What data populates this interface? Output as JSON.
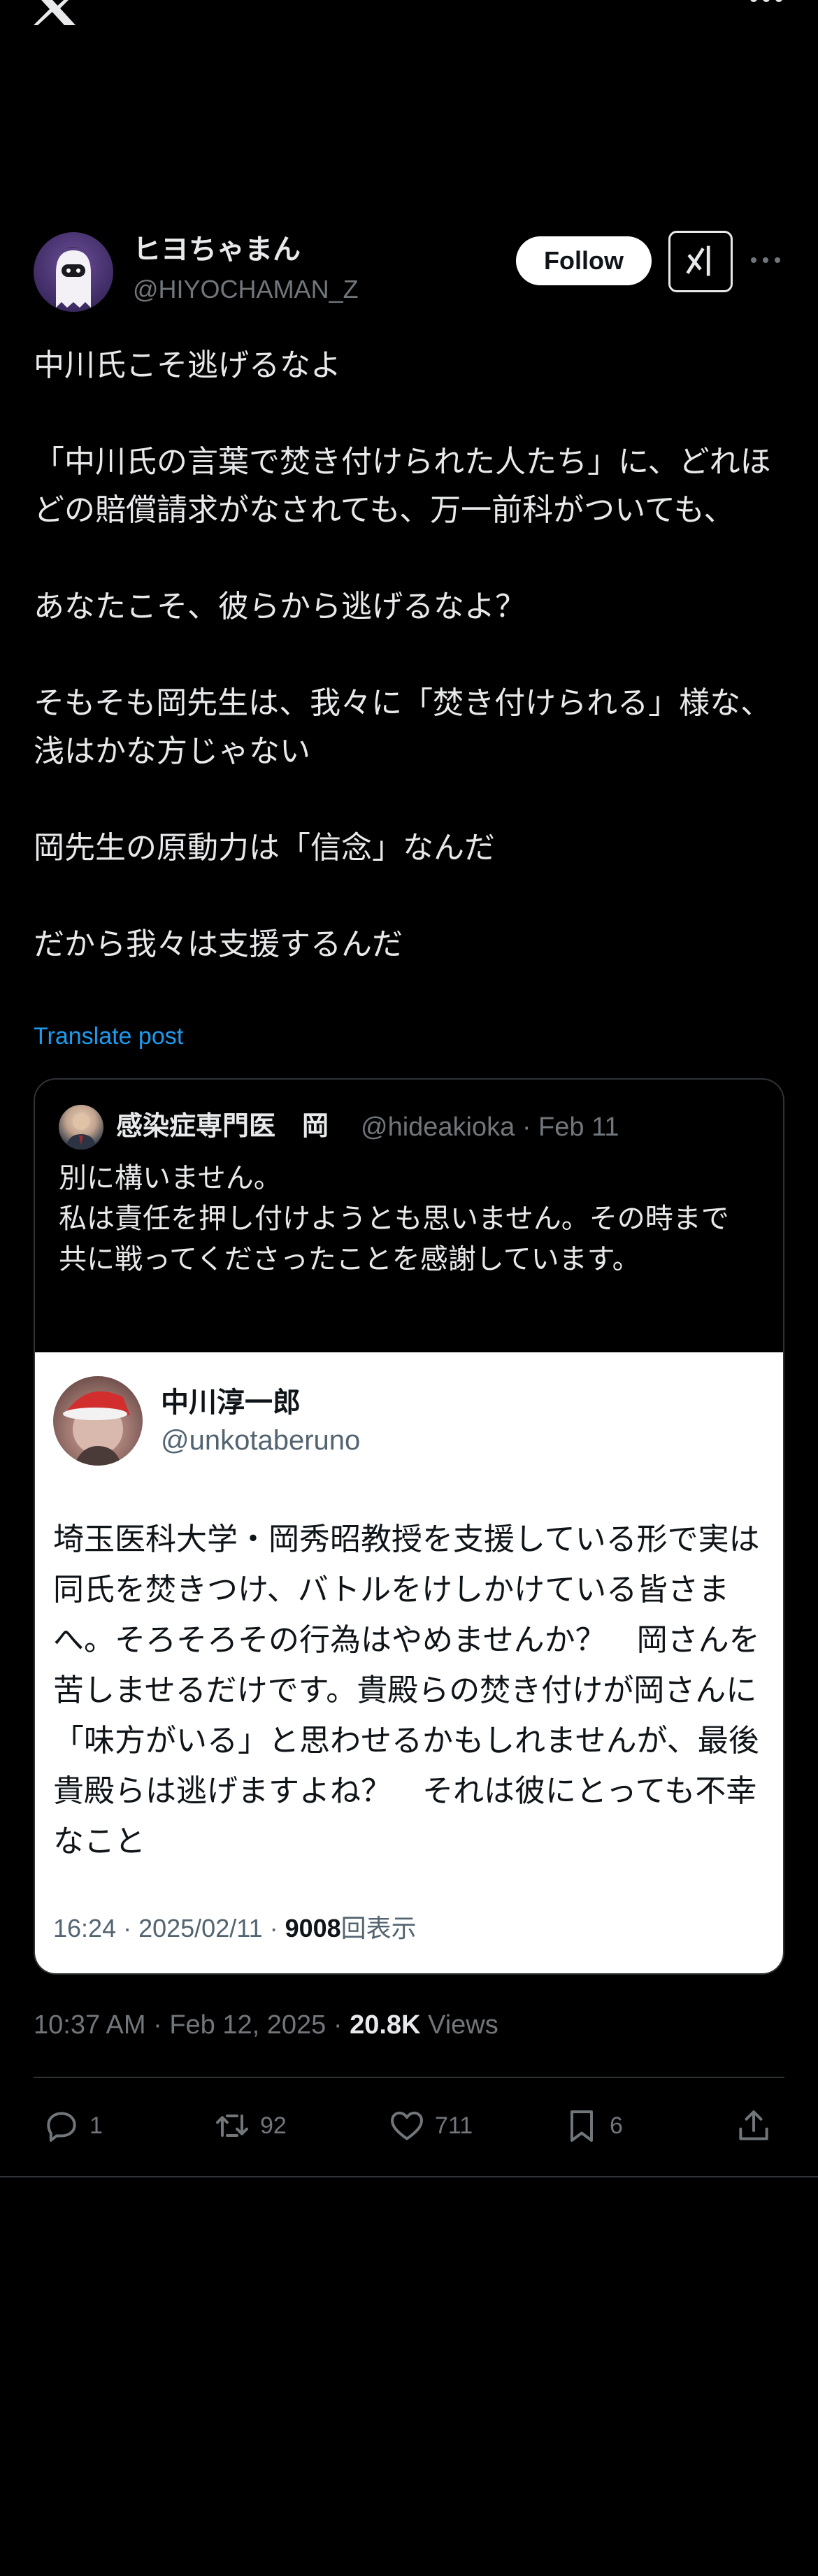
{
  "header": {
    "display_name": "ヒヨちゃまん",
    "handle": "@HIYOCHAMAN_Z",
    "follow_label": "Follow"
  },
  "tweet": {
    "paragraphs": [
      "中川氏こそ逃げるなよ",
      "「中川氏の言葉で焚き付けられた人たち」に、どれほどの賠償請求がなされても、万一前科がついても、",
      "あなたこそ、彼らから逃げるなよ？",
      "そもそも岡先生は、我々に「焚き付けられる」様な、浅はかな方じゃない",
      "岡先生の原動力は「信念」なんだ",
      "だから我々は支援するんだ"
    ],
    "translate_label": "Translate post",
    "timestamp": "10:37 AM · Feb 12, 2025 · ",
    "views_count": "20.8K",
    "views_label": "Views"
  },
  "quote": {
    "name": "感染症専門医　岡",
    "handle_date": "@hideakioka · Feb 11",
    "lines": [
      "別に構いません。",
      "私は責任を押し付けようとも思いません。その時まで",
      "共に戦ってくださったことを感謝しています。"
    ],
    "embedded": {
      "name": "中川淳一郎",
      "handle": "@unkotaberuno",
      "text": "埼玉医科大学・岡秀昭教授を支援している形で実は同氏を焚きつけ、バトルをけしかけている皆さまへ。そろそろその行為はやめませんか？　岡さんを苦しませるだけです。貴殿らの焚き付けが岡さんに「味方がいる」と思わせるかもしれませんが、最後貴殿らは逃げますよね？　それは彼にとっても不幸なこと",
      "meta_time": "16:24 · 2025/02/11 · ",
      "meta_views": "9008",
      "meta_views_label": "回表示"
    }
  },
  "actions": {
    "reply": "1",
    "retweet": "92",
    "like": "711",
    "bookmark": "6"
  },
  "colors": {
    "background": "#000000",
    "text": "#e7e9ea",
    "muted": "#71767b",
    "link": "#1d9bf0",
    "border": "#2f3336"
  }
}
